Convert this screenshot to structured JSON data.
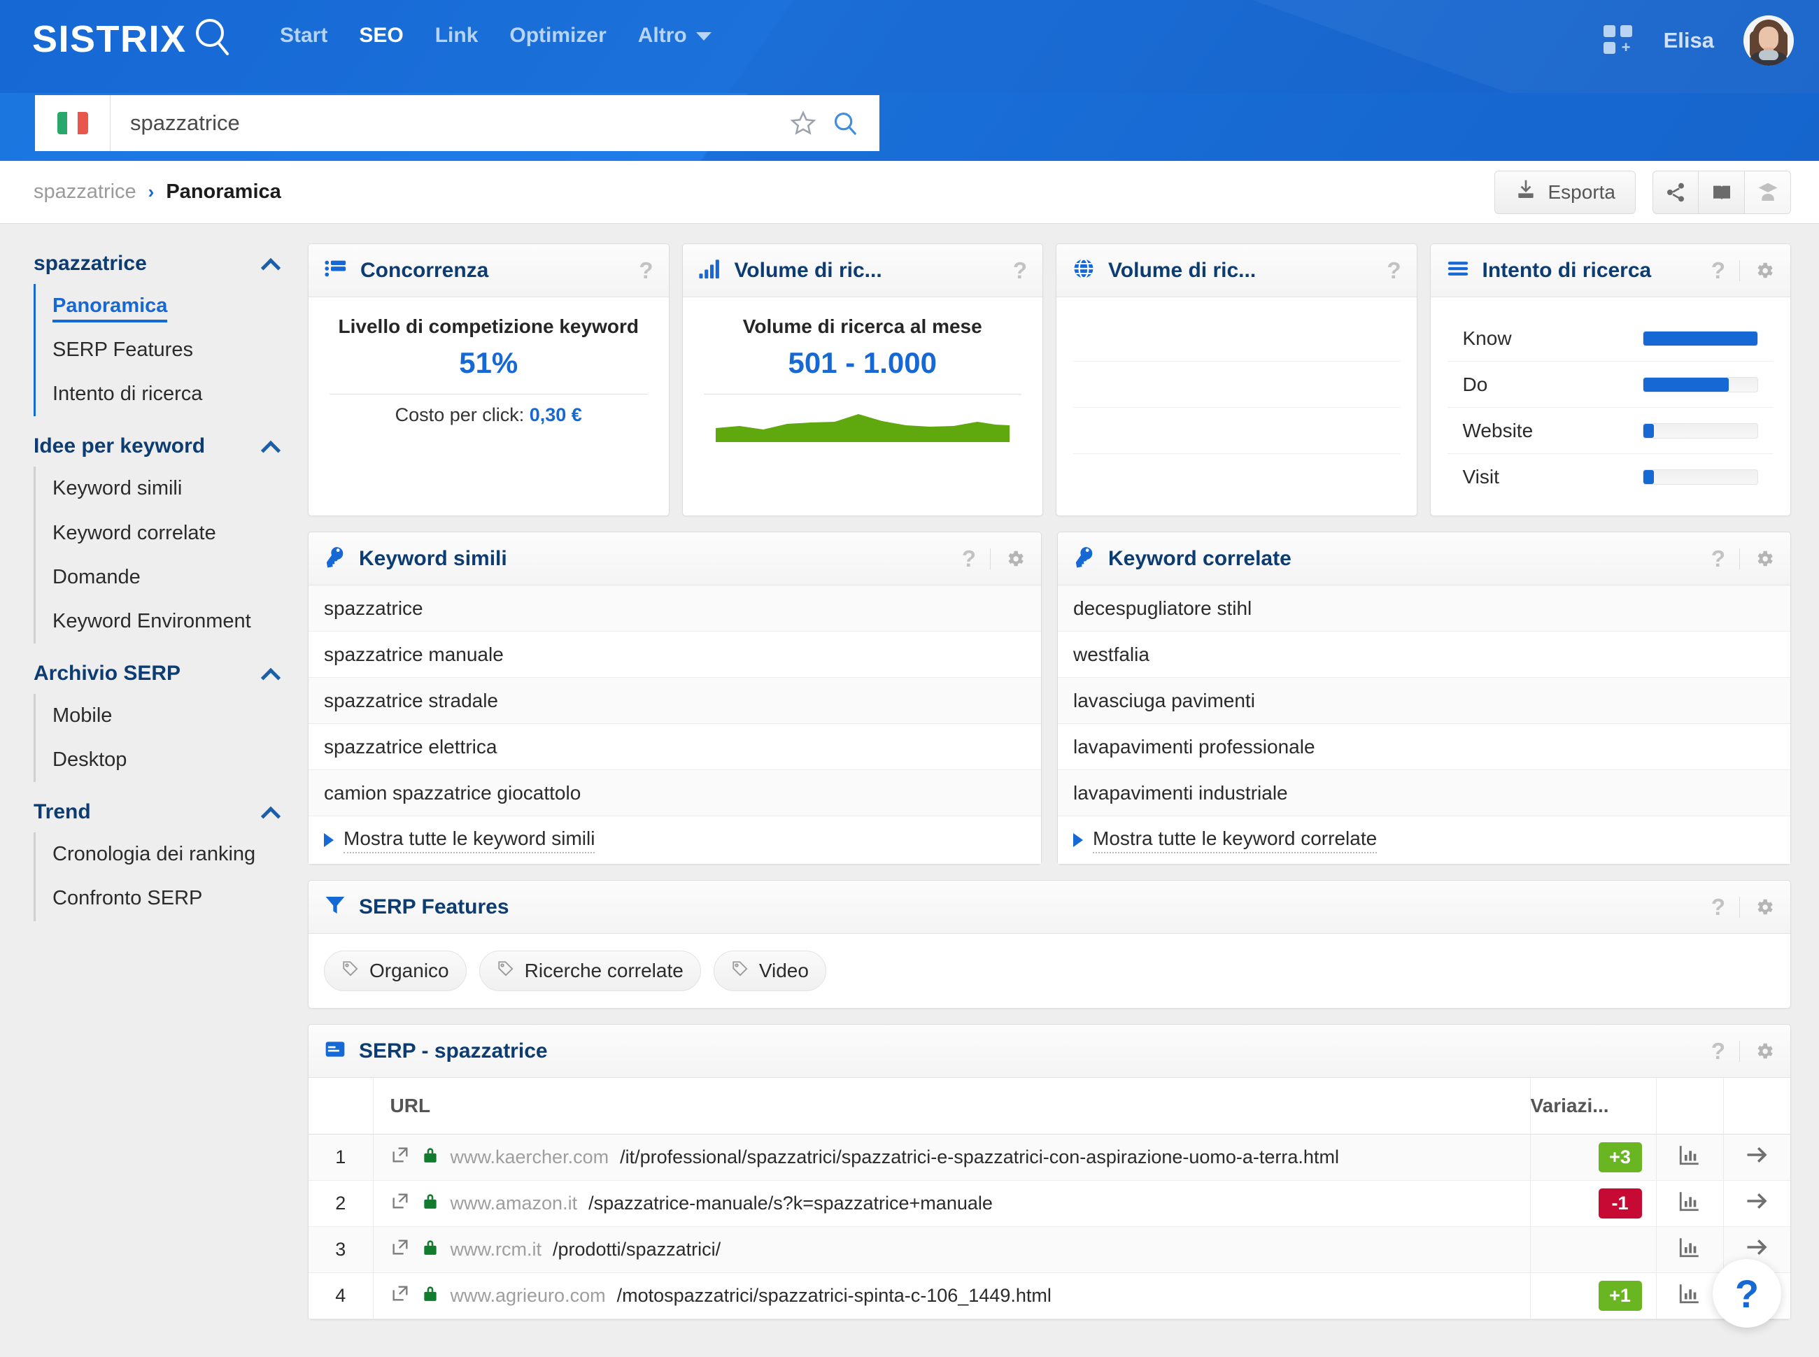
{
  "brand": {
    "name": "SISTRIX",
    "accent": "#1668d4"
  },
  "header": {
    "nav": [
      {
        "label": "Start",
        "active": false
      },
      {
        "label": "SEO",
        "active": true
      },
      {
        "label": "Link",
        "active": false
      },
      {
        "label": "Optimizer",
        "active": false
      },
      {
        "label": "Altro",
        "active": false,
        "caret": true
      }
    ],
    "user_name": "Elisa"
  },
  "search": {
    "value": "spazzatrice",
    "placeholder": "spazzatrice",
    "country": "IT"
  },
  "breadcrumb": {
    "parent": "spazzatrice",
    "separator": "›",
    "current": "Panoramica"
  },
  "toolbar": {
    "export_label": "Esporta"
  },
  "sidebar": {
    "groups": [
      {
        "title": "spazzatrice",
        "active": true,
        "items": [
          {
            "label": "Panoramica",
            "selected": true
          },
          {
            "label": "SERP Features",
            "selected": false
          },
          {
            "label": "Intento di ricerca",
            "selected": false
          }
        ]
      },
      {
        "title": "Idee per keyword",
        "active": false,
        "items": [
          {
            "label": "Keyword simili",
            "selected": false
          },
          {
            "label": "Keyword correlate",
            "selected": false
          },
          {
            "label": "Domande",
            "selected": false
          },
          {
            "label": "Keyword Environment",
            "selected": false
          }
        ]
      },
      {
        "title": "Archivio SERP",
        "active": false,
        "items": [
          {
            "label": "Mobile",
            "selected": false
          },
          {
            "label": "Desktop",
            "selected": false
          }
        ]
      },
      {
        "title": "Trend",
        "active": false,
        "items": [
          {
            "label": "Cronologia dei ranking",
            "selected": false
          },
          {
            "label": "Confronto SERP",
            "selected": false
          }
        ]
      }
    ]
  },
  "cards": {
    "competition": {
      "title": "Concorrenza",
      "label": "Livello di competizione keyword",
      "value": "51%",
      "cpc_label": "Costo per click:",
      "cpc_value": "0,30 €"
    },
    "volume": {
      "title": "Volume di ric...",
      "label": "Volume di ricerca al mese",
      "value": "501 - 1.000",
      "sparkline_color": "#5fa80d"
    },
    "volume_country": {
      "title": "Volume di ric...",
      "empty_rows": 4
    },
    "intent": {
      "title": "Intento di ricerca",
      "rows": [
        {
          "label": "Know",
          "percent": 100
        },
        {
          "label": "Do",
          "percent": 75
        },
        {
          "label": "Website",
          "percent": 9
        },
        {
          "label": "Visit",
          "percent": 9
        }
      ]
    }
  },
  "keyword_similar": {
    "title": "Keyword simili",
    "items": [
      "spazzatrice",
      "spazzatrice manuale",
      "spazzatrice stradale",
      "spazzatrice elettrica",
      "camion spazzatrice giocattolo"
    ],
    "more_label": "Mostra tutte le keyword simili"
  },
  "keyword_related": {
    "title": "Keyword correlate",
    "items": [
      "decespugliatore stihl",
      "westfalia",
      "lavasciuga pavimenti",
      "lavapavimenti professionale",
      "lavapavimenti industriale"
    ],
    "more_label": "Mostra tutte le keyword correlate"
  },
  "serp_features": {
    "title": "SERP Features",
    "chips": [
      "Organico",
      "Ricerche correlate",
      "Video"
    ]
  },
  "serp_table": {
    "title": "SERP - spazzatrice",
    "columns": {
      "url": "URL",
      "variation": "Variazi..."
    },
    "rows": [
      {
        "pos": "1",
        "domain": "www.kaercher.com",
        "path": "/it/professional/spazzatrici/spazzatrici-e-spazzatrici-con-aspirazione-uomo-a-terra.html",
        "variation": "+3",
        "variation_dir": "pos"
      },
      {
        "pos": "2",
        "domain": "www.amazon.it",
        "path": "/spazzatrice-manuale/s?k=spazzatrice+manuale",
        "variation": "-1",
        "variation_dir": "neg"
      },
      {
        "pos": "3",
        "domain": "www.rcm.it",
        "path": "/prodotti/spazzatrici/",
        "variation": "",
        "variation_dir": "none"
      },
      {
        "pos": "4",
        "domain": "www.agrieuro.com",
        "path": "/motospazzatrici/spazzatrici-spinta-c-106_1449.html",
        "variation": "+1",
        "variation_dir": "pos"
      }
    ]
  },
  "help_fab": {
    "label": "?"
  }
}
